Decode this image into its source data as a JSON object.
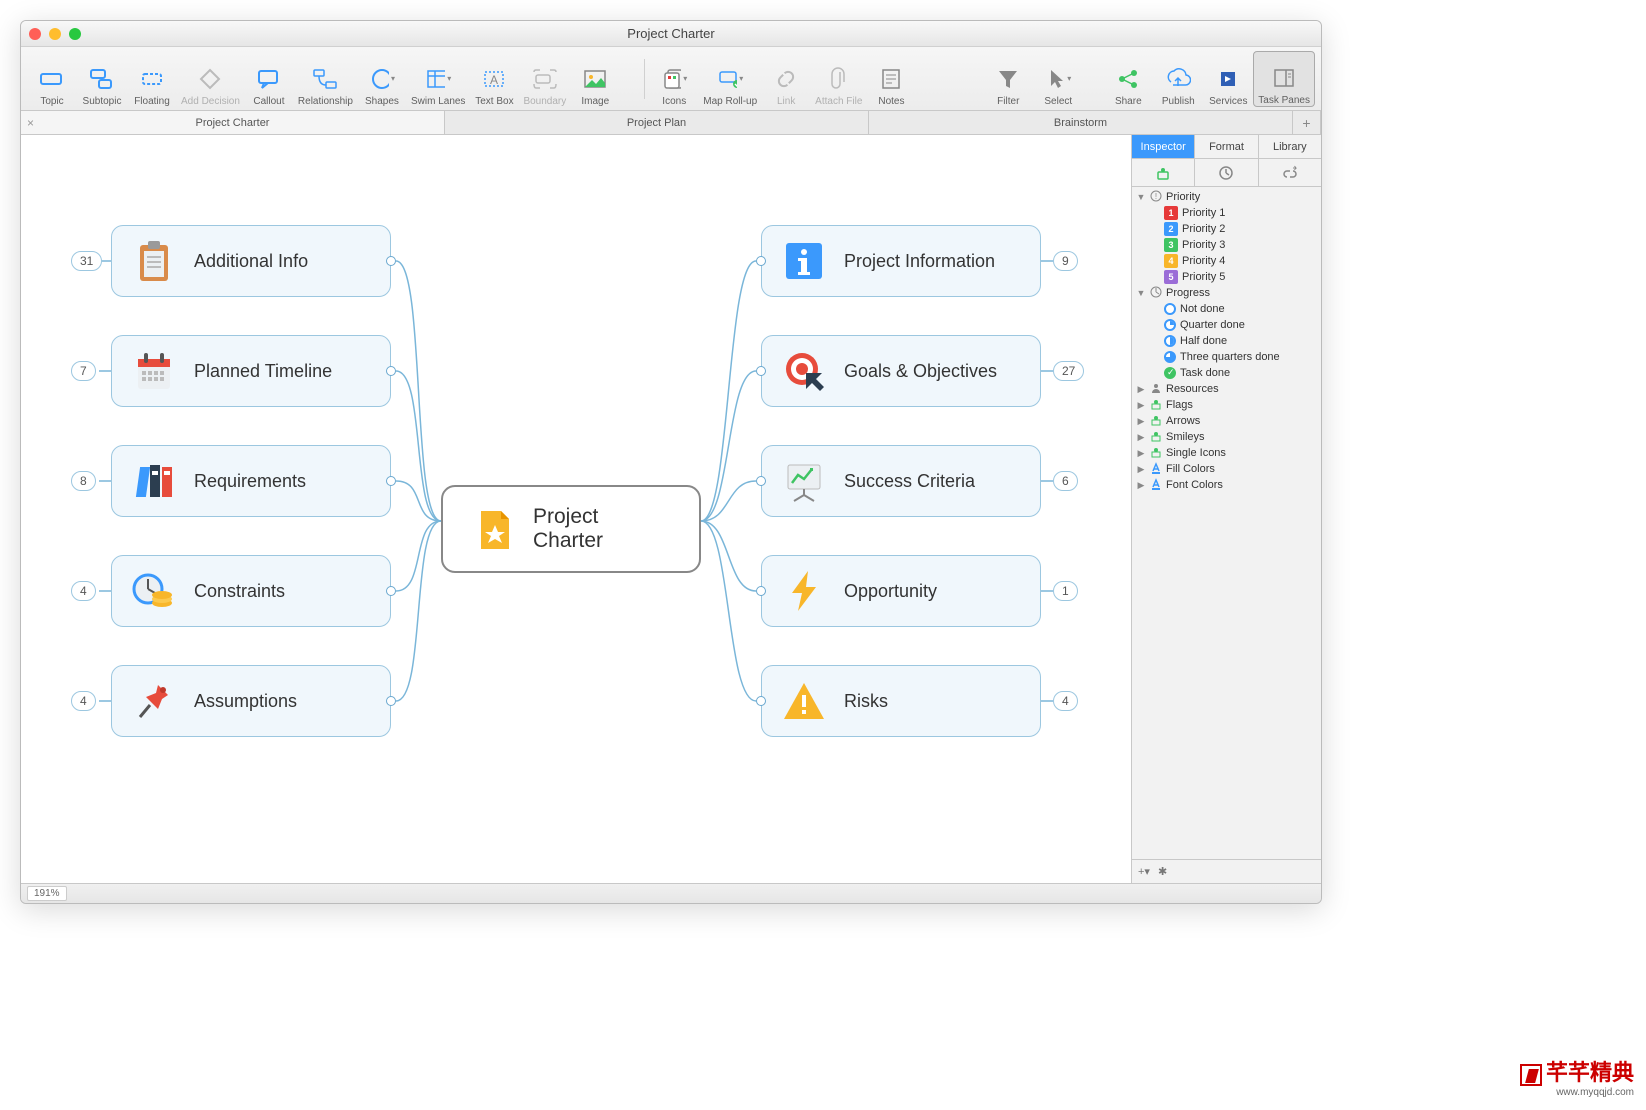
{
  "window": {
    "title": "Project Charter"
  },
  "toolbar": [
    {
      "label": "Topic",
      "icon": "topic",
      "enabled": true
    },
    {
      "label": "Subtopic",
      "icon": "subtopic",
      "enabled": true
    },
    {
      "label": "Floating",
      "icon": "floating",
      "enabled": true
    },
    {
      "label": "Add Decision",
      "icon": "decision",
      "enabled": false
    },
    {
      "label": "Callout",
      "icon": "callout",
      "enabled": true
    },
    {
      "label": "Relationship",
      "icon": "relationship",
      "enabled": true
    },
    {
      "label": "Shapes",
      "icon": "shapes",
      "enabled": true
    },
    {
      "label": "Swim Lanes",
      "icon": "swimlanes",
      "enabled": true
    },
    {
      "label": "Text Box",
      "icon": "textbox",
      "enabled": true
    },
    {
      "label": "Boundary",
      "icon": "boundary",
      "enabled": false
    },
    {
      "label": "Image",
      "icon": "image",
      "enabled": true
    }
  ],
  "toolbar2": [
    {
      "label": "Icons",
      "icon": "icons",
      "enabled": true
    },
    {
      "label": "Map Roll-up",
      "icon": "rollup",
      "enabled": true
    },
    {
      "label": "Link",
      "icon": "link",
      "enabled": false
    },
    {
      "label": "Attach File",
      "icon": "attach",
      "enabled": false
    },
    {
      "label": "Notes",
      "icon": "notes",
      "enabled": true
    }
  ],
  "toolbar3": [
    {
      "label": "Filter",
      "icon": "filter",
      "enabled": true
    },
    {
      "label": "Select",
      "icon": "select",
      "enabled": true
    }
  ],
  "toolbar4": [
    {
      "label": "Share",
      "icon": "share",
      "enabled": true
    },
    {
      "label": "Publish",
      "icon": "publish",
      "enabled": true
    },
    {
      "label": "Services",
      "icon": "services",
      "enabled": true
    },
    {
      "label": "Task Panes",
      "icon": "taskpanes",
      "enabled": true,
      "active": true
    }
  ],
  "tabs": [
    {
      "label": "Project Charter",
      "active": true
    },
    {
      "label": "Project Plan",
      "active": false
    },
    {
      "label": "Brainstorm",
      "active": false
    }
  ],
  "mindmap": {
    "center": {
      "label": "Project Charter",
      "icon": "star-doc"
    },
    "left": [
      {
        "label": "Additional Info",
        "icon": "clipboard",
        "count": 31
      },
      {
        "label": "Planned Timeline",
        "icon": "calendar",
        "count": 7
      },
      {
        "label": "Requirements",
        "icon": "binders",
        "count": 8
      },
      {
        "label": "Constraints",
        "icon": "clock-coins",
        "count": 4
      },
      {
        "label": "Assumptions",
        "icon": "pushpin",
        "count": 4
      }
    ],
    "right": [
      {
        "label": "Project Information",
        "icon": "info",
        "count": 9
      },
      {
        "label": "Goals & Objectives",
        "icon": "target",
        "count": 27
      },
      {
        "label": "Success Criteria",
        "icon": "chart-board",
        "count": 6
      },
      {
        "label": "Opportunity",
        "icon": "lightning",
        "count": 1
      },
      {
        "label": "Risks",
        "icon": "warning",
        "count": 4
      }
    ]
  },
  "inspector": {
    "tabs": [
      {
        "label": "Inspector",
        "active": true
      },
      {
        "label": "Format",
        "active": false
      },
      {
        "label": "Library",
        "active": false
      }
    ],
    "groups": [
      {
        "label": "Priority",
        "expanded": true,
        "icon": "priority",
        "items": [
          {
            "label": "Priority 1",
            "color": "#e63939",
            "num": "1"
          },
          {
            "label": "Priority 2",
            "color": "#3b99fc",
            "num": "2"
          },
          {
            "label": "Priority 3",
            "color": "#3fc463",
            "num": "3"
          },
          {
            "label": "Priority 4",
            "color": "#f8b62a",
            "num": "4"
          },
          {
            "label": "Priority 5",
            "color": "#9b6dd7",
            "num": "5"
          }
        ]
      },
      {
        "label": "Progress",
        "expanded": true,
        "icon": "progress",
        "items": [
          {
            "label": "Not done",
            "kind": "circ"
          },
          {
            "label": "Quarter done",
            "kind": "q"
          },
          {
            "label": "Half done",
            "kind": "h"
          },
          {
            "label": "Three quarters done",
            "kind": "tq"
          },
          {
            "label": "Task done",
            "kind": "done"
          }
        ]
      },
      {
        "label": "Resources",
        "expanded": false,
        "icon": "resources"
      },
      {
        "label": "Flags",
        "expanded": false,
        "icon": "flags"
      },
      {
        "label": "Arrows",
        "expanded": false,
        "icon": "arrows"
      },
      {
        "label": "Smileys",
        "expanded": false,
        "icon": "smileys"
      },
      {
        "label": "Single Icons",
        "expanded": false,
        "icon": "single"
      },
      {
        "label": "Fill Colors",
        "expanded": false,
        "icon": "fill"
      },
      {
        "label": "Font Colors",
        "expanded": false,
        "icon": "font"
      }
    ]
  },
  "status": {
    "zoom": "191%"
  },
  "watermark": {
    "text": "芊芊精典",
    "url": "www.myqqjd.com"
  }
}
